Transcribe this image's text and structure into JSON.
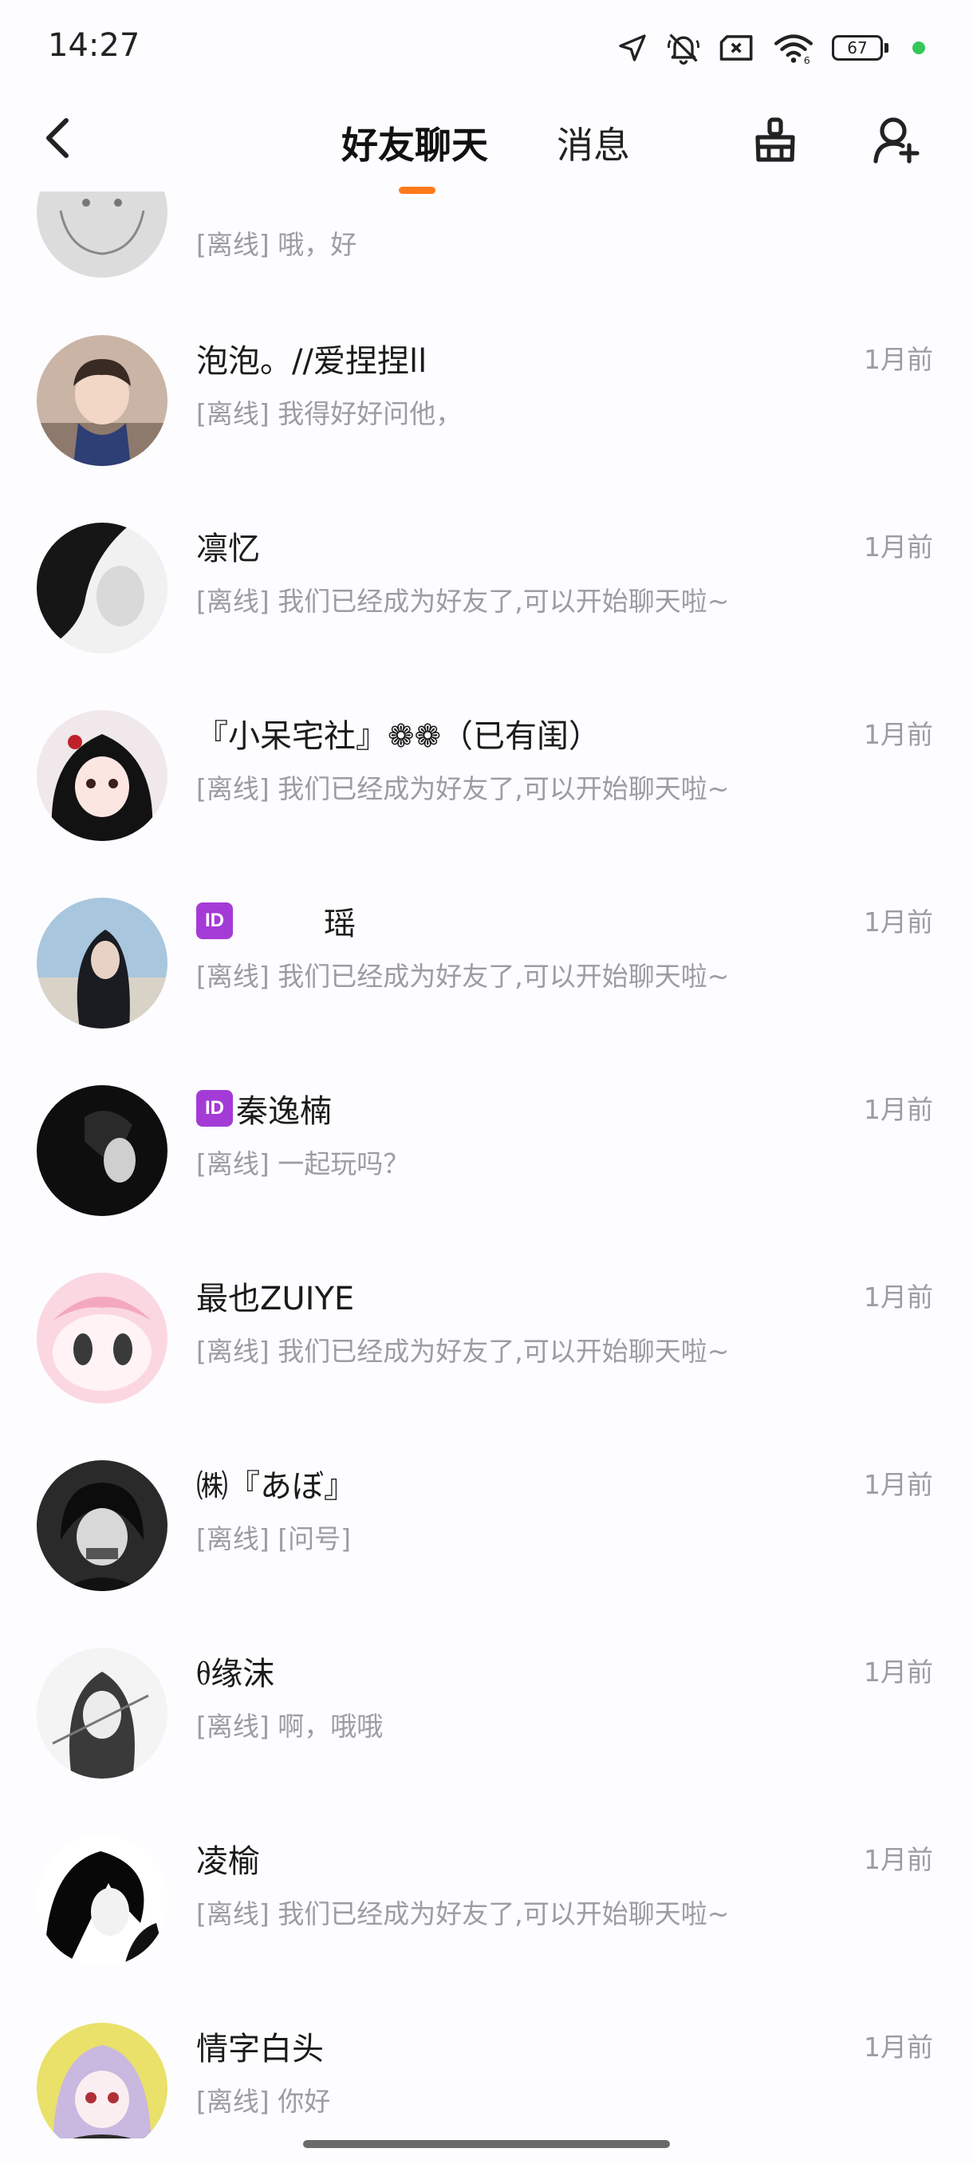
{
  "status_bar": {
    "time": "14:27",
    "battery": "67",
    "icons": [
      "location-arrow-icon",
      "bell-muted-icon",
      "sim-off-icon",
      "wifi-icon",
      "battery-icon",
      "green-dot-icon"
    ]
  },
  "header": {
    "tabs": [
      {
        "label": "好友聊天",
        "active": true
      },
      {
        "label": "消息",
        "active": false
      }
    ],
    "accent_color": "#ff7a1a"
  },
  "partial_row": {
    "preview": "[离线] 哦，好"
  },
  "chats": [
    {
      "name": "泡泡。//爱捏捏ll",
      "badge": "",
      "preview": "[离线] 我得好好问他，",
      "time": "1月前"
    },
    {
      "name": "凛忆",
      "badge": "",
      "preview": "[离线] 我们已经成为好友了,可以开始聊天啦~",
      "time": "1月前"
    },
    {
      "name": "『小呆宅社』❁❁（已有闺）",
      "badge": "",
      "preview": "[离线] 我们已经成为好友了,可以开始聊天啦~",
      "time": "1月前"
    },
    {
      "name": "瑶",
      "badge": "ID",
      "preview": "[离线] 我们已经成为好友了,可以开始聊天啦~",
      "time": "1月前"
    },
    {
      "name": "秦逸楠",
      "badge": "ID",
      "preview": "[离线] 一起玩吗？",
      "time": "1月前"
    },
    {
      "name": "最也ZUIYE",
      "badge": "",
      "preview": "[离线] 我们已经成为好友了,可以开始聊天啦~",
      "time": "1月前"
    },
    {
      "name": "㈱『あぼ』",
      "badge": "",
      "preview": "[离线] [问号]",
      "time": "1月前"
    },
    {
      "name": "ᦲ缘沫",
      "badge": "",
      "preview": "[离线] 啊，哦哦",
      "time": "1月前"
    },
    {
      "name": "凌榆",
      "badge": "",
      "preview": "[离线] 我们已经成为好友了,可以开始聊天啦~",
      "time": "1月前"
    },
    {
      "name": "情字白头",
      "badge": "",
      "preview": "[离线] 你好",
      "time": "1月前"
    }
  ]
}
